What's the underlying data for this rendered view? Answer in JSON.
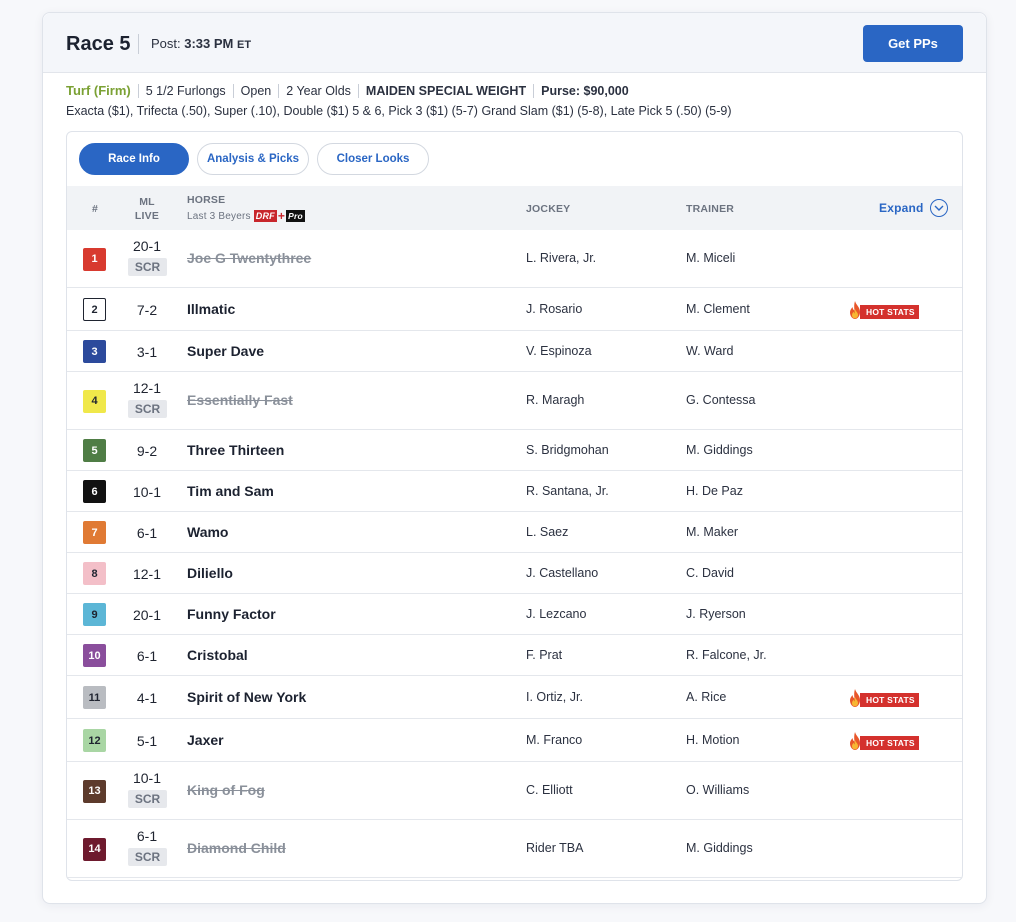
{
  "header": {
    "race_title": "Race 5",
    "post_label": "Post:",
    "post_time": "3:33 PM",
    "post_tz": "ET",
    "get_pps_label": "Get PPs"
  },
  "race_info": {
    "surface": "Turf (Firm)",
    "distance": "5 1/2 Furlongs",
    "sex": "Open",
    "age": "2 Year Olds",
    "race_type": "MAIDEN SPECIAL WEIGHT",
    "purse": "Purse: $90,000",
    "wagers": "Exacta ($1), Trifecta (.50), Super (.10), Double ($1) 5 & 6, Pick 3 ($1) (5-7) Grand Slam ($1) (5-8), Late Pick 5 (.50) (5-9)"
  },
  "tabs": [
    {
      "label": "Race Info",
      "active": true
    },
    {
      "label": "Analysis & Picks",
      "active": false
    },
    {
      "label": "Closer Looks",
      "active": false
    }
  ],
  "table": {
    "col_num": "#",
    "col_ml_1": "ML",
    "col_ml_2": "LIVE",
    "col_horse": "HORSE",
    "col_horse_sub": "Last 3 Beyers",
    "drf_logo_text": "DRF",
    "drf_logo_plus": "+",
    "drf_logo_pro": "Pro",
    "col_jockey": "JOCKEY",
    "col_trainer": "TRAINER",
    "expand_label": "Expand",
    "scr_label": "SCR",
    "hot_stats_label": "HOT STATS"
  },
  "entries": [
    {
      "num": "1",
      "odds": "20-1",
      "scratched": true,
      "horse": "Joe G Twentythree",
      "jockey": "L. Rivera, Jr.",
      "trainer": "M. Miceli",
      "hot": false,
      "bg": "#d83a2f",
      "fg": "#ffffff"
    },
    {
      "num": "2",
      "odds": "7-2",
      "scratched": false,
      "horse": "Illmatic",
      "jockey": "J. Rosario",
      "trainer": "M. Clement",
      "hot": true,
      "bg": "#ffffff",
      "fg": "#1f2430"
    },
    {
      "num": "3",
      "odds": "3-1",
      "scratched": false,
      "horse": "Super Dave",
      "jockey": "V. Espinoza",
      "trainer": "W. Ward",
      "hot": false,
      "bg": "#2c4a9c",
      "fg": "#ffffff"
    },
    {
      "num": "4",
      "odds": "12-1",
      "scratched": true,
      "horse": "Essentially Fast",
      "jockey": "R. Maragh",
      "trainer": "G. Contessa",
      "hot": false,
      "bg": "#f0e84a",
      "fg": "#1f2430"
    },
    {
      "num": "5",
      "odds": "9-2",
      "scratched": false,
      "horse": "Three Thirteen",
      "jockey": "S. Bridgmohan",
      "trainer": "M. Giddings",
      "hot": false,
      "bg": "#4f7d45",
      "fg": "#ffffff"
    },
    {
      "num": "6",
      "odds": "10-1",
      "scratched": false,
      "horse": "Tim and Sam",
      "jockey": "R. Santana, Jr.",
      "trainer": "H. De Paz",
      "hot": false,
      "bg": "#111111",
      "fg": "#ffffff"
    },
    {
      "num": "7",
      "odds": "6-1",
      "scratched": false,
      "horse": "Wamo",
      "jockey": "L. Saez",
      "trainer": "M. Maker",
      "hot": false,
      "bg": "#e07a34",
      "fg": "#ffffff"
    },
    {
      "num": "8",
      "odds": "12-1",
      "scratched": false,
      "horse": "Diliello",
      "jockey": "J. Castellano",
      "trainer": "C. David",
      "hot": false,
      "bg": "#f3bfc8",
      "fg": "#1f2430"
    },
    {
      "num": "9",
      "odds": "20-1",
      "scratched": false,
      "horse": "Funny Factor",
      "jockey": "J. Lezcano",
      "trainer": "J. Ryerson",
      "hot": false,
      "bg": "#5cb6d6",
      "fg": "#1f2430"
    },
    {
      "num": "10",
      "odds": "6-1",
      "scratched": false,
      "horse": "Cristobal",
      "jockey": "F. Prat",
      "trainer": "R. Falcone, Jr.",
      "hot": false,
      "bg": "#8a4e9c",
      "fg": "#ffffff"
    },
    {
      "num": "11",
      "odds": "4-1",
      "scratched": false,
      "horse": "Spirit of New York",
      "jockey": "I. Ortiz, Jr.",
      "trainer": "A. Rice",
      "hot": true,
      "bg": "#b9bcc1",
      "fg": "#1f2430"
    },
    {
      "num": "12",
      "odds": "5-1",
      "scratched": false,
      "horse": "Jaxer",
      "jockey": "M. Franco",
      "trainer": "H. Motion",
      "hot": true,
      "bg": "#a9d6a4",
      "fg": "#1f2430"
    },
    {
      "num": "13",
      "odds": "10-1",
      "scratched": true,
      "horse": "King of Fog",
      "jockey": "C. Elliott",
      "trainer": "O. Williams",
      "hot": false,
      "bg": "#5d3b2c",
      "fg": "#ffffff"
    },
    {
      "num": "14",
      "odds": "6-1",
      "scratched": true,
      "horse": "Diamond Child",
      "jockey": "Rider TBA",
      "trainer": "M. Giddings",
      "hot": false,
      "bg": "#6e1a2e",
      "fg": "#ffffff"
    }
  ],
  "colors": {
    "accent": "#2a66c4",
    "surface_green": "#7ba134",
    "hot_red": "#d4312d"
  }
}
